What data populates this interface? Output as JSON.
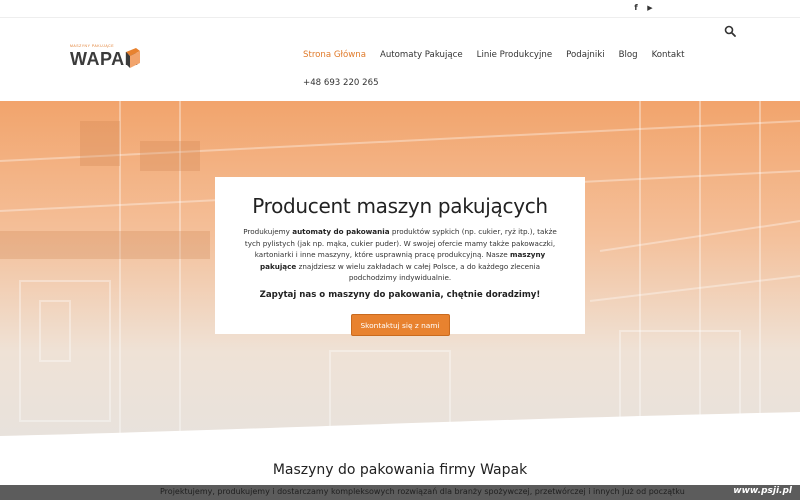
{
  "topbar": {
    "social": [
      {
        "icon": "facebook-icon",
        "glyph": "f"
      },
      {
        "icon": "youtube-icon",
        "glyph": "▶"
      }
    ]
  },
  "header": {
    "logo": {
      "tagline": "MASZYNY PAKUJĄCE",
      "word": "WAPAK"
    },
    "nav": [
      {
        "label": "Strona Główna",
        "active": true
      },
      {
        "label": "Automaty Pakujące",
        "active": false
      },
      {
        "label": "Linie Produkcyjne",
        "active": false
      },
      {
        "label": "Podajniki",
        "active": false
      },
      {
        "label": "Blog",
        "active": false
      },
      {
        "label": "Kontakt",
        "active": false
      }
    ],
    "phone": "+48 693 220 265",
    "search_icon": "search-icon"
  },
  "hero": {
    "title": "Producent maszyn pakujących",
    "desc_1": "Produkujemy ",
    "desc_b1": "automaty do pakowania",
    "desc_2": " produktów sypkich (np. cukier, ryż itp.), także tych pylistych (jak np. mąka, cukier puder). W swojej ofercie mamy także pakowaczki, kartoniarki i inne maszyny, które usprawnią pracę produkcyjną. Nasze ",
    "desc_b2": "maszyny pakujące",
    "desc_3": " znajdziesz w wielu zakładach w całej Polsce, a do każdego zlecenia podchodzimy indywidualnie.",
    "ask": "Zapytaj nas o maszyny do pakowania, chętnie doradzimy!",
    "button": "Skontaktuj się z nami"
  },
  "section": {
    "title": "Maszyny do pakowania firmy Wapak",
    "lead": "Projektujemy, produkujemy i dostarczamy kompleksowych rozwiązań dla branży spożywczej, przetwórczej i innych już od początku"
  },
  "watermark": "www.psji.pl",
  "colors": {
    "accent": "#e8822f",
    "active_nav": "#e07a2a"
  }
}
